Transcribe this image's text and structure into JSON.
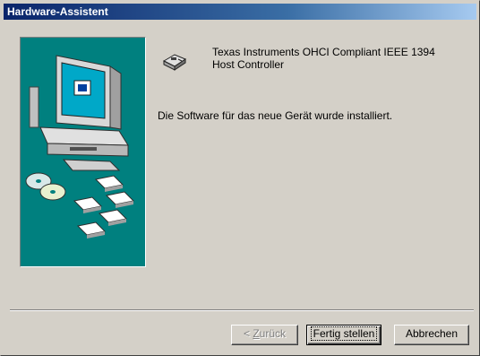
{
  "window": {
    "title": "Hardware-Assistent"
  },
  "device": {
    "name": "Texas Instruments OHCI Compliant IEEE 1394\nHost Controller"
  },
  "message": "Die Software für das neue Gerät wurde installiert.",
  "buttons": {
    "back_prefix": "< ",
    "back_accel": "Z",
    "back_rest": "urück",
    "finish": "Fertig stellen",
    "cancel": "Abbrechen"
  },
  "colors": {
    "titlebar": "#0a246a",
    "art_background": "#00807f",
    "face": "#d4d0c8"
  },
  "icons": {
    "art": "computer-with-discs-illustration",
    "device": "host-controller-card-icon"
  }
}
